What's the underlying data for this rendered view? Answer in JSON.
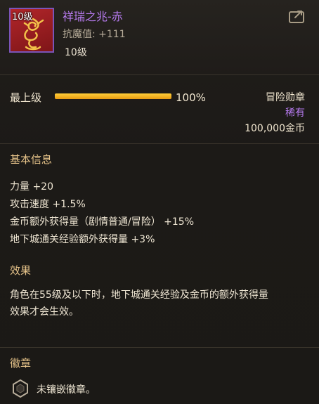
{
  "item": {
    "level_badge": "10级",
    "name": "祥瑞之兆-赤",
    "resist_label": "抗魔值",
    "resist_value": "+111",
    "level_text": "10级"
  },
  "tier": {
    "label": "最上级",
    "percent_text": "100%",
    "progress": 1.0
  },
  "meta": {
    "type": "冒险勋章",
    "rarity": "稀有",
    "price": "100,000金币"
  },
  "sections": {
    "basic_title": "基本信息",
    "effect_title": "效果",
    "emblem_title": "徽章"
  },
  "stats": [
    "力量 +20",
    "攻击速度 +1.5%",
    "金币额外获得量（剧情普通/冒险） +15%",
    "地下城通关经验额外获得量 +3%"
  ],
  "effect": {
    "line1": "角色在55级及以下时，地下城通关经验及金币的额外获得量",
    "line2": "效果才会生效。"
  },
  "emblem": {
    "status": "未镶嵌徽章。"
  },
  "colors": {
    "rarity_purple": "#b77bf0",
    "section_gold": "#e7c48a",
    "bar_orange": "#f0a81c",
    "icon_red": "#b1262a"
  }
}
